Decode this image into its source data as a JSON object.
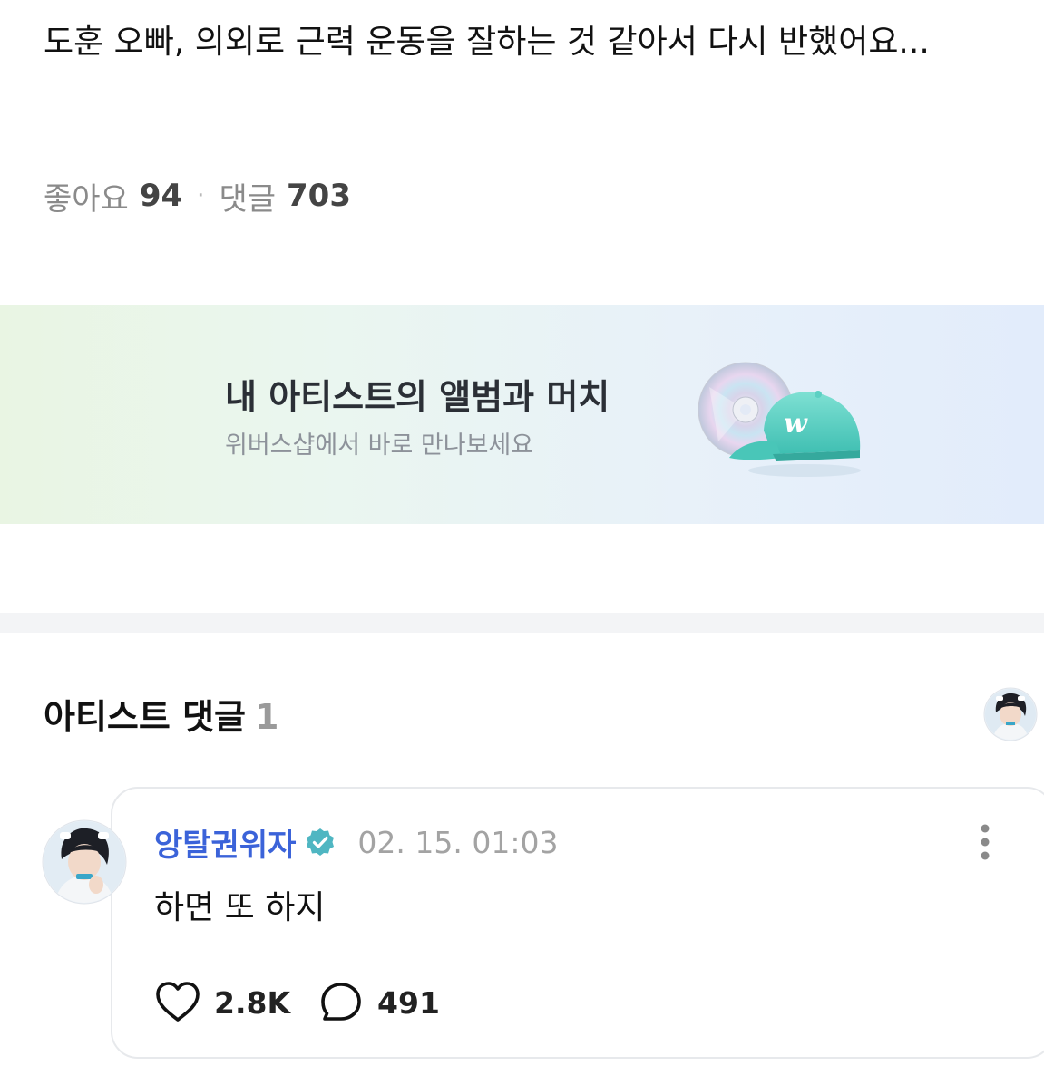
{
  "post": {
    "text": "도훈 오빠, 의외로 근력 운동을 잘하는 것 같아서 다시 반했어요...",
    "stats": {
      "likes_label": "좋아요",
      "likes_count": "94",
      "separator": "·",
      "comments_label": "댓글",
      "comments_count": "703"
    }
  },
  "banner": {
    "title": "내 아티스트의 앨범과 머치",
    "subtitle": "위버스샵에서 바로 만나보세요",
    "icons": [
      "cd-icon",
      "cap-icon"
    ],
    "cap_letter": "w",
    "colors": {
      "cap": "#5ecfc3",
      "brand_letter": "#ffffff"
    }
  },
  "artist_comments": {
    "title": "아티스트 댓글",
    "count": "1",
    "header_icon": "artist-avatar"
  },
  "comment": {
    "author": "앙탈권위자",
    "verified_icon": "verified-badge-icon",
    "date": "02. 15. 01:03",
    "body": "하면 또 하지",
    "likes": "2.8K",
    "replies": "491",
    "colors": {
      "author": "#3b63d9",
      "verified": "#4fb6c2"
    }
  }
}
